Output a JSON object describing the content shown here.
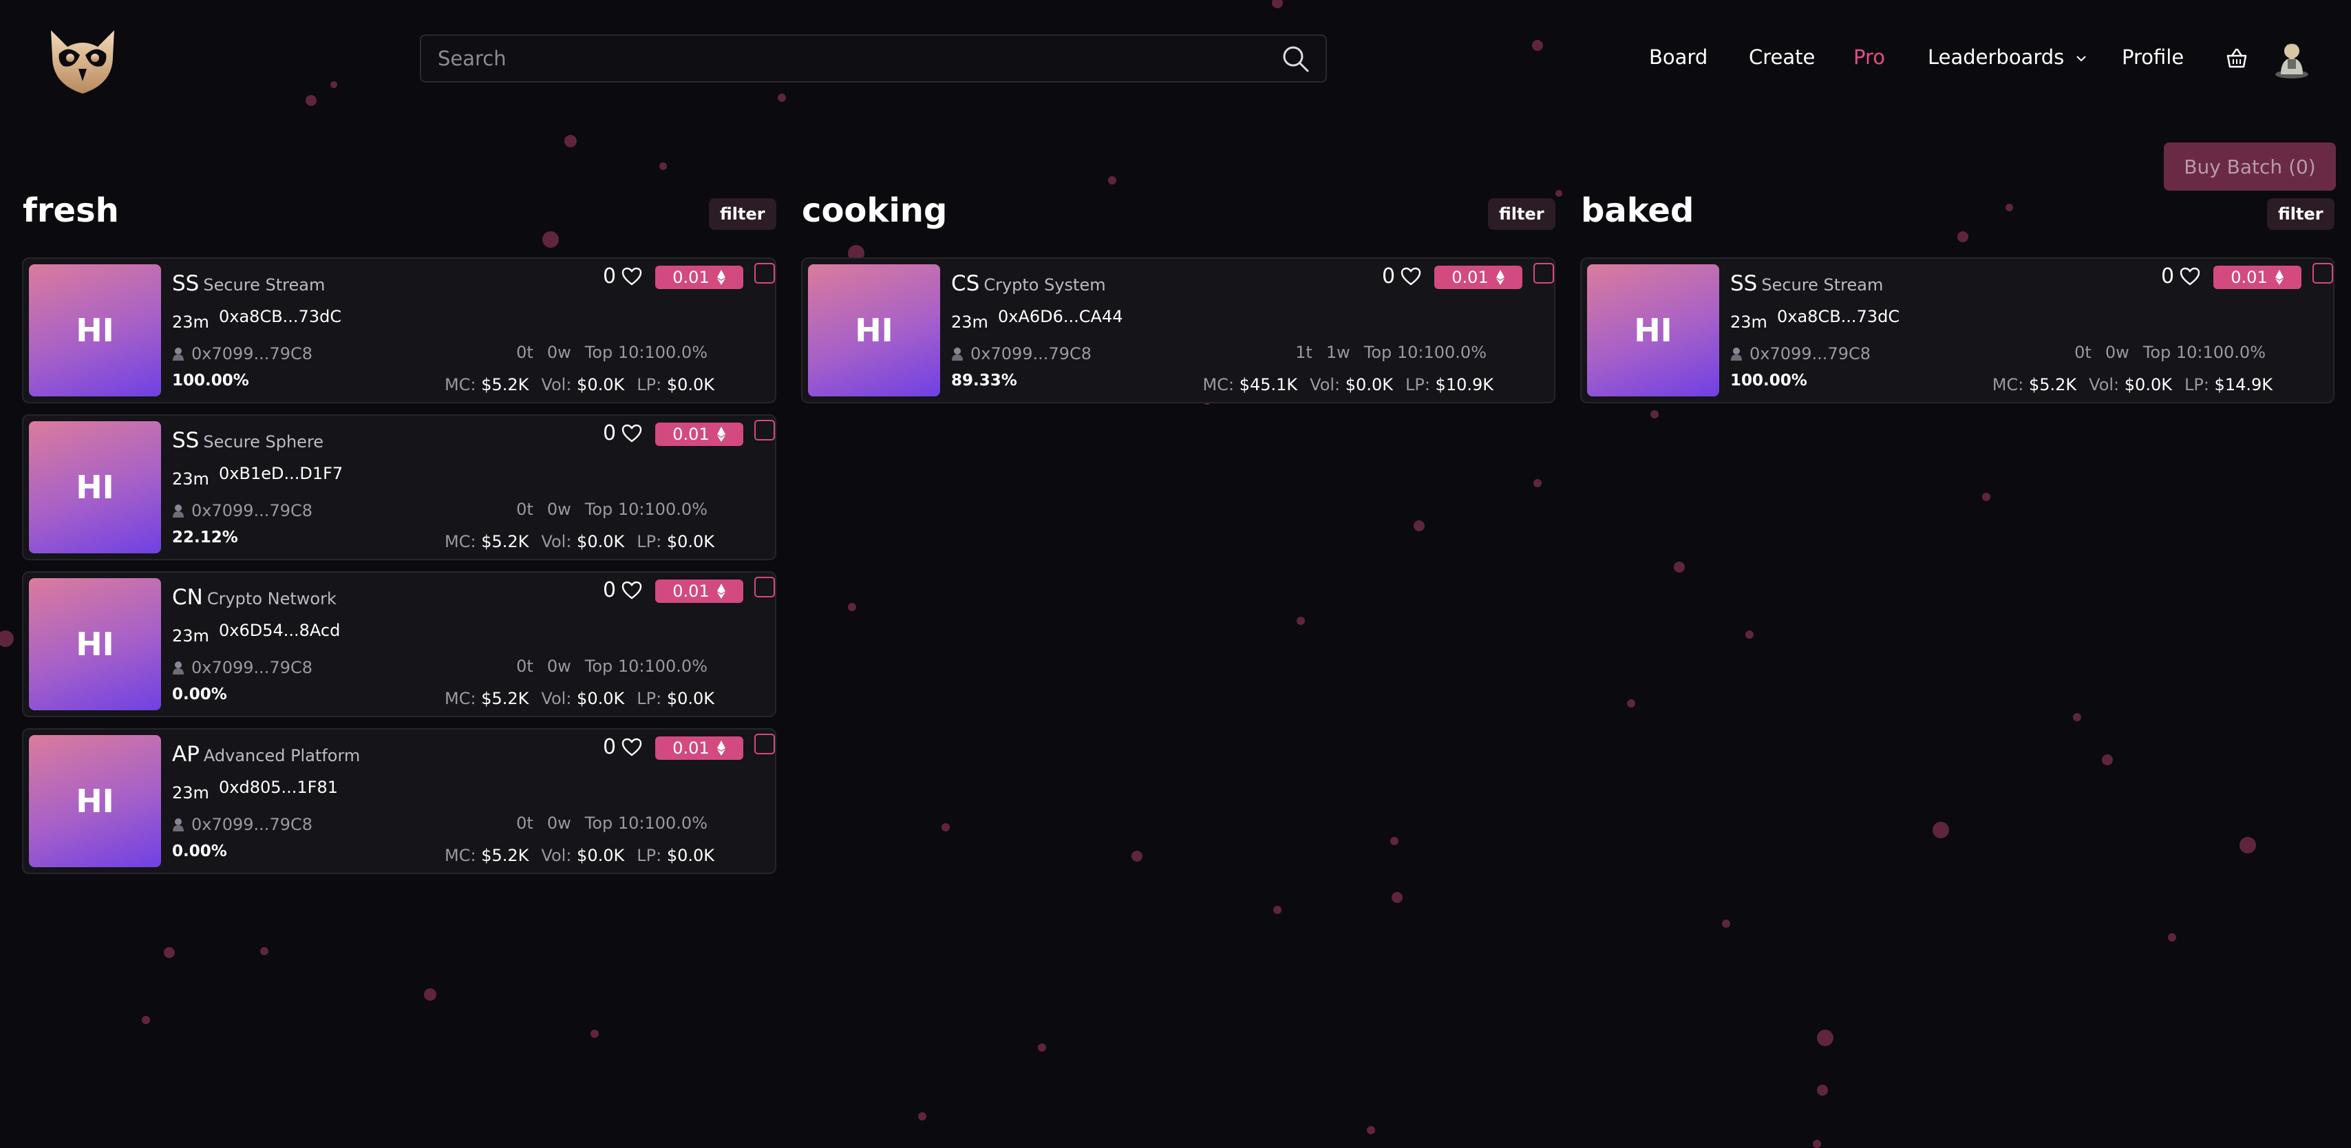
{
  "colors": {
    "accent": "#d24a80",
    "pro": "#e0508a",
    "background": "#0b0a0e",
    "card": "#151418",
    "dot": "#6e2a48"
  },
  "header": {
    "logo": "owl-logo-icon",
    "search_placeholder": "Search",
    "nav": {
      "board": "Board",
      "create": "Create",
      "pro": "Pro",
      "leaderboards": "Leaderboards",
      "profile": "Profile"
    }
  },
  "buy_batch": "Buy Batch (0)",
  "columns": [
    {
      "title": "fresh",
      "filter": "filter",
      "cards": [
        {
          "thumb": "HI",
          "symbol": "SS",
          "name": "Secure Stream",
          "age": "23m",
          "address": "0xa8CB...73dC",
          "creator": "0x7099...79C8",
          "progress": "100.00%",
          "likes": "0",
          "price": "0.01",
          "t": "0t",
          "w": "0w",
          "top": "Top 10:100.0%",
          "mc_label": "MC:",
          "mc": "$5.2K",
          "vol_label": "Vol:",
          "vol": "$0.0K",
          "lp_label": "LP:",
          "lp": "$0.0K"
        },
        {
          "thumb": "HI",
          "symbol": "SS",
          "name": "Secure Sphere",
          "age": "23m",
          "address": "0xB1eD...D1F7",
          "creator": "0x7099...79C8",
          "progress": "22.12%",
          "likes": "0",
          "price": "0.01",
          "t": "0t",
          "w": "0w",
          "top": "Top 10:100.0%",
          "mc_label": "MC:",
          "mc": "$5.2K",
          "vol_label": "Vol:",
          "vol": "$0.0K",
          "lp_label": "LP:",
          "lp": "$0.0K"
        },
        {
          "thumb": "HI",
          "symbol": "CN",
          "name": "Crypto Network",
          "age": "23m",
          "address": "0x6D54...8Acd",
          "creator": "0x7099...79C8",
          "progress": "0.00%",
          "likes": "0",
          "price": "0.01",
          "t": "0t",
          "w": "0w",
          "top": "Top 10:100.0%",
          "mc_label": "MC:",
          "mc": "$5.2K",
          "vol_label": "Vol:",
          "vol": "$0.0K",
          "lp_label": "LP:",
          "lp": "$0.0K"
        },
        {
          "thumb": "HI",
          "symbol": "AP",
          "name": "Advanced Platform",
          "age": "23m",
          "address": "0xd805...1F81",
          "creator": "0x7099...79C8",
          "progress": "0.00%",
          "likes": "0",
          "price": "0.01",
          "t": "0t",
          "w": "0w",
          "top": "Top 10:100.0%",
          "mc_label": "MC:",
          "mc": "$5.2K",
          "vol_label": "Vol:",
          "vol": "$0.0K",
          "lp_label": "LP:",
          "lp": "$0.0K"
        }
      ]
    },
    {
      "title": "cooking",
      "filter": "filter",
      "cards": [
        {
          "thumb": "HI",
          "symbol": "CS",
          "name": "Crypto System",
          "age": "23m",
          "address": "0xA6D6...CA44",
          "creator": "0x7099...79C8",
          "progress": "89.33%",
          "likes": "0",
          "price": "0.01",
          "t": "1t",
          "w": "1w",
          "top": "Top 10:100.0%",
          "mc_label": "MC:",
          "mc": "$45.1K",
          "vol_label": "Vol:",
          "vol": "$0.0K",
          "lp_label": "LP:",
          "lp": "$10.9K"
        }
      ]
    },
    {
      "title": "baked",
      "filter": "filter",
      "cards": [
        {
          "thumb": "HI",
          "symbol": "SS",
          "name": "Secure Stream",
          "age": "23m",
          "address": "0xa8CB...73dC",
          "creator": "0x7099...79C8",
          "progress": "100.00%",
          "likes": "0",
          "price": "0.01",
          "t": "0t",
          "w": "0w",
          "top": "Top 10:100.0%",
          "mc_label": "MC:",
          "mc": "$5.2K",
          "vol_label": "Vol:",
          "vol": "$0.0K",
          "lp_label": "LP:",
          "lp": "$14.9K"
        }
      ]
    }
  ]
}
